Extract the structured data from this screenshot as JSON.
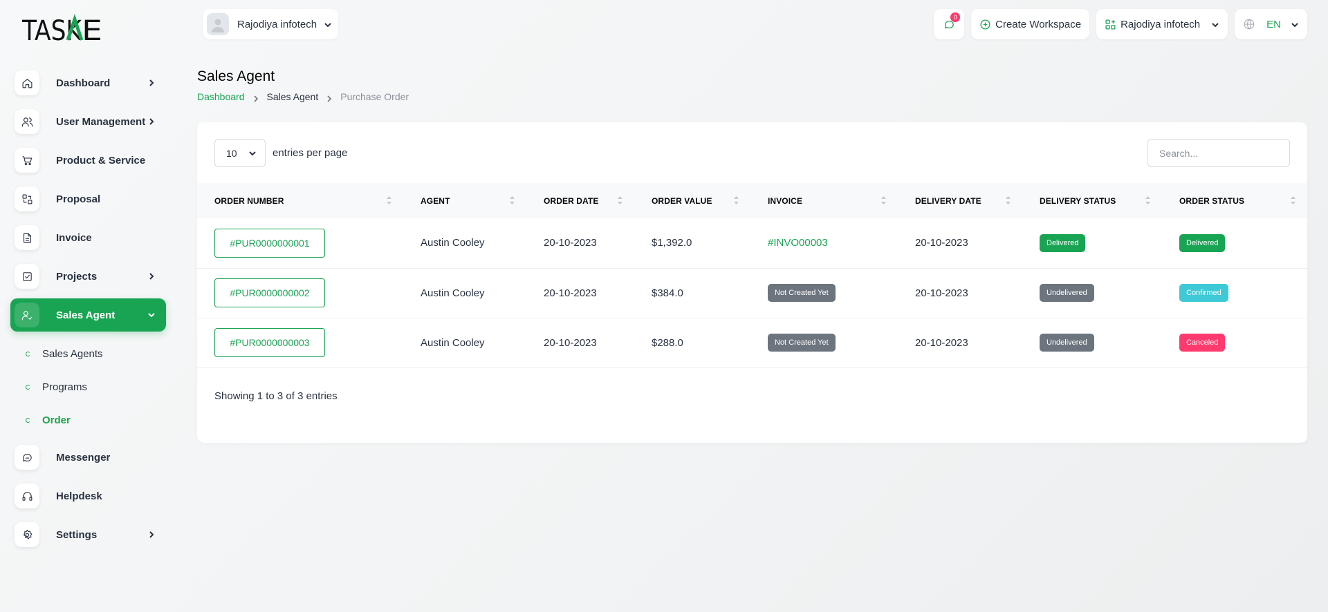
{
  "brand": {
    "logo_text": "TASKAE"
  },
  "sidebar": {
    "items": [
      {
        "label": "Dashboard",
        "icon": "home-icon",
        "has_arrow": true
      },
      {
        "label": "User Management",
        "icon": "users-icon",
        "has_arrow": true
      },
      {
        "label": "Product & Service",
        "icon": "cart-icon",
        "has_arrow": false
      },
      {
        "label": "Proposal",
        "icon": "proposal-icon",
        "has_arrow": false
      },
      {
        "label": "Invoice",
        "icon": "file-icon",
        "has_arrow": false
      },
      {
        "label": "Projects",
        "icon": "checkbox-icon",
        "has_arrow": true
      },
      {
        "label": "Sales Agent",
        "icon": "user-check-icon",
        "has_arrow": true,
        "active": true
      },
      {
        "label": "Messenger",
        "icon": "chat-icon",
        "has_arrow": false
      },
      {
        "label": "Helpdesk",
        "icon": "headset-icon",
        "has_arrow": false
      },
      {
        "label": "Settings",
        "icon": "gear-icon",
        "has_arrow": true
      }
    ],
    "sales_agent_sub": [
      {
        "label": "Sales Agents"
      },
      {
        "label": "Programs"
      },
      {
        "label": "Order",
        "active": true
      }
    ]
  },
  "topbar": {
    "org_name": "Rajodiya infotech",
    "messages_count": "0",
    "create_workspace": "Create Workspace",
    "workspace_name": "Rajodiya infotech",
    "language": "EN"
  },
  "page": {
    "title": "Sales Agent",
    "breadcrumb": [
      "Dashboard",
      "Sales Agent",
      "Purchase Order"
    ]
  },
  "table_controls": {
    "per_page_value": "10",
    "per_page_label": "entries per page",
    "search_placeholder": "Search..."
  },
  "table": {
    "columns": [
      "ORDER NUMBER",
      "AGENT",
      "ORDER DATE",
      "ORDER VALUE",
      "INVOICE",
      "DELIVERY DATE",
      "DELIVERY STATUS",
      "ORDER STATUS"
    ],
    "rows": [
      {
        "order_number": "#PUR0000000001",
        "agent": "Austin Cooley",
        "order_date": "20-10-2023",
        "order_value": "$1,392.0",
        "invoice": "#INVO00003",
        "invoice_is_link": true,
        "delivery_date": "20-10-2023",
        "delivery_status": "Delivered",
        "order_status": "Delivered"
      },
      {
        "order_number": "#PUR0000000002",
        "agent": "Austin Cooley",
        "order_date": "20-10-2023",
        "order_value": "$384.0",
        "invoice": "Not Created Yet",
        "invoice_is_link": false,
        "delivery_date": "20-10-2023",
        "delivery_status": "Undelivered",
        "order_status": "Confirmed"
      },
      {
        "order_number": "#PUR0000000003",
        "agent": "Austin Cooley",
        "order_date": "20-10-2023",
        "order_value": "$288.0",
        "invoice": "Not Created Yet",
        "invoice_is_link": false,
        "delivery_date": "20-10-2023",
        "delivery_status": "Undelivered",
        "order_status": "Canceled"
      }
    ],
    "footer": "Showing 1 to 3 of 3 entries"
  },
  "colors": {
    "accent": "#19a453",
    "gray_badge": "#6c757d",
    "confirmed": "#3ec9d6",
    "canceled": "#ff3a6e"
  }
}
